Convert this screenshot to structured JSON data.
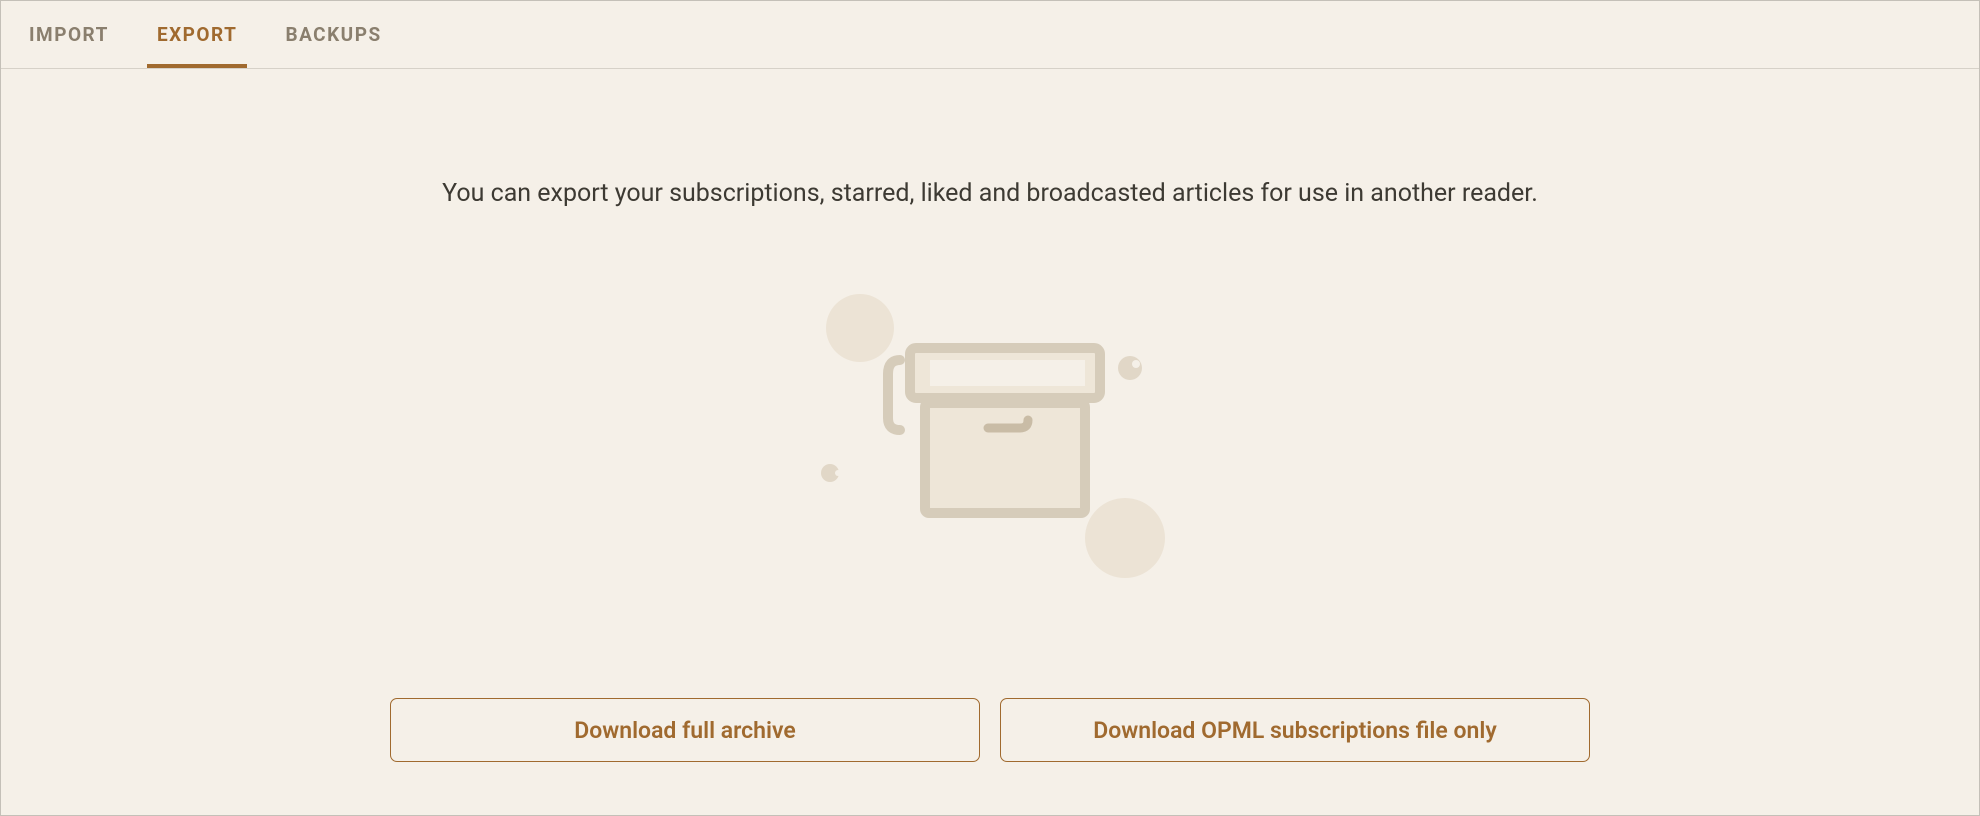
{
  "tabs": {
    "import": "IMPORT",
    "export": "EXPORT",
    "backups": "BACKUPS"
  },
  "description": "You can export your subscriptions, starred, liked and broadcasted articles for use in another reader.",
  "buttons": {
    "full_archive": "Download full archive",
    "opml_only": "Download OPML subscriptions file only"
  },
  "colors": {
    "accent": "#a06a2f",
    "bg": "#f5f0e8",
    "text": "#3d3a33",
    "muted": "#8a7f6e",
    "illustration_outline": "#d6ccba",
    "illustration_fill": "#eee6d8",
    "illustration_bubble": "#ece3d5"
  }
}
